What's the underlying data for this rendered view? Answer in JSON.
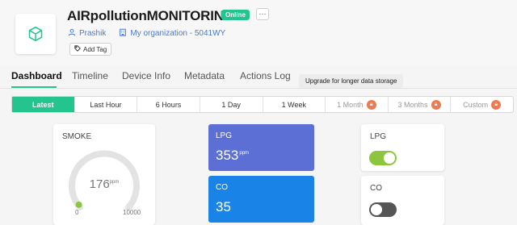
{
  "device": {
    "title": "AIRpollutionMONITORING",
    "status": "Online",
    "more": "⋯",
    "owner": "Prashik",
    "organization": "My organization - 5041WY",
    "add_tag": "Add Tag"
  },
  "tabs": [
    {
      "label": "Dashboard"
    },
    {
      "label": "Timeline"
    },
    {
      "label": "Device Info"
    },
    {
      "label": "Metadata"
    },
    {
      "label": "Actions Log"
    }
  ],
  "tooltip": "Upgrade for longer data storage",
  "ranges": [
    {
      "label": "Latest",
      "active": true,
      "locked": false
    },
    {
      "label": "Last Hour",
      "locked": false
    },
    {
      "label": "6 Hours",
      "locked": false
    },
    {
      "label": "1 Day",
      "locked": false
    },
    {
      "label": "1 Week",
      "locked": false
    },
    {
      "label": "1 Month",
      "locked": true
    },
    {
      "label": "3 Months",
      "locked": true
    },
    {
      "label": "Custom",
      "locked": true
    }
  ],
  "gauge": {
    "title": "SMOKE",
    "value": "176",
    "unit": "ppm",
    "min": "0",
    "max": "10000",
    "fraction": 0.0176
  },
  "values": {
    "lpg": {
      "title": "LPG",
      "value": "353",
      "unit": "ppm"
    },
    "co": {
      "title": "CO",
      "value": "35"
    }
  },
  "switches": {
    "lpg": {
      "title": "LPG",
      "on": true
    },
    "co": {
      "title": "CO",
      "on": false
    }
  },
  "colors": {
    "accent": "#23c48e",
    "lpg_card": "#5b6fd4",
    "co_card": "#1a83e8",
    "lock": "#f07a50",
    "toggle_on": "#8cc63f"
  }
}
